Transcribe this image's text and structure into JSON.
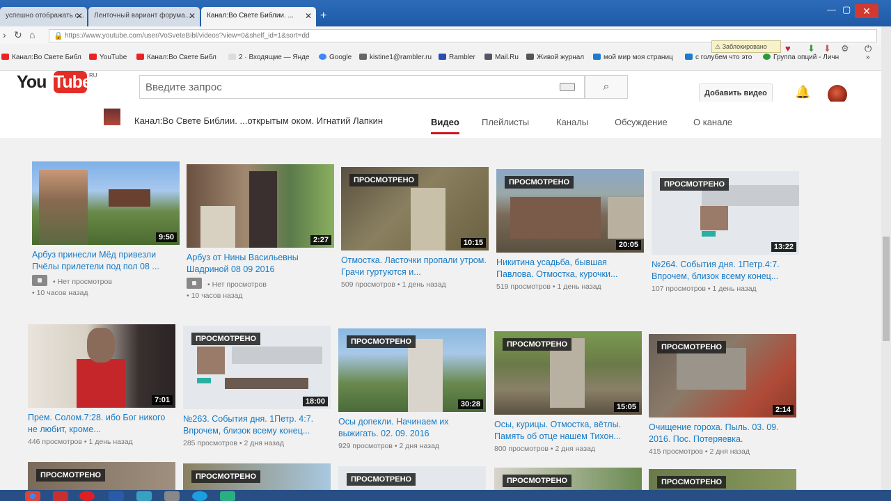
{
  "browser": {
    "tabs": [
      {
        "title": "успешно отображать с...",
        "active": false
      },
      {
        "title": "Ленточный вариант форума...",
        "active": false
      },
      {
        "title": "Канал:Во Свете Библии. ...",
        "active": true
      }
    ],
    "url": "https://www.youtube.com/user/VoSveteBibl/videos?view=0&shelf_id=1&sort=dd",
    "bookmarks": [
      "Канал:Во Свете Библ",
      "YouTube",
      "Канал:Во Свете Библ",
      "2 · Входящие — Янде",
      "Google",
      "kistine1@rambler.ru",
      "Rambler",
      "Mail.Ru",
      "Живой журнал",
      "мой мир моя страниц",
      "с голубем что это",
      "Группа опций - Личн"
    ],
    "blocked_label": "Заблокировано"
  },
  "youtube": {
    "logo_you": "You",
    "logo_tube": "Tube",
    "logo_region": "RU",
    "search_placeholder": "Введите запрос",
    "add_video": "Добавить видео"
  },
  "channel": {
    "name": "Канал:Во Свете Библии. ...открытым оком. Игнатий Лапкин",
    "tabs": [
      "Видео",
      "Плейлисты",
      "Каналы",
      "Обсуждение",
      "О канале"
    ],
    "active_tab": "Видео"
  },
  "watched_label": "ПРОСМОТРЕНО",
  "videos": [
    {
      "title": "Арбуз принесли Мёд привезли Пчёлы прилетели под пол 08 ...",
      "duration": "9:50",
      "views": "Нет просмотров",
      "age": "10 часов назад",
      "watched": false,
      "private": true
    },
    {
      "title": "Арбуз от Нины Васильевны Шадриной 08 09 2016",
      "duration": "2:27",
      "views": "Нет просмотров",
      "age": "10 часов назад",
      "watched": false,
      "private": true
    },
    {
      "title": "Отмостка. Ласточки пропали утром. Грачи гуртуются и...",
      "duration": "10:15",
      "views": "509 просмотров",
      "age": "1 день назад",
      "watched": true,
      "private": false
    },
    {
      "title": "Никитина усадьба, бывшая Павлова. Отмостка, курочки...",
      "duration": "20:05",
      "views": "519 просмотров",
      "age": "1 день назад",
      "watched": true,
      "private": false
    },
    {
      "title": "№264. События дня. 1Петр.4:7. Впрочем, близок всему конец...",
      "duration": "13:22",
      "views": "107 просмотров",
      "age": "1 день назад",
      "watched": true,
      "private": false
    },
    {
      "title": "Прем. Солом.7:28. ибо Бог никого не любит, кроме...",
      "duration": "7:01",
      "views": "446 просмотров",
      "age": "1 день назад",
      "watched": false,
      "private": false
    },
    {
      "title": "№263. События дня. 1Петр. 4:7. Впрочем, близок всему конец...",
      "duration": "18:00",
      "views": "285 просмотров",
      "age": "2 дня назад",
      "watched": true,
      "private": false
    },
    {
      "title": "Осы допекли. Начинаем их выжигать. 02. 09. 2016",
      "duration": "30:28",
      "views": "929 просмотров",
      "age": "2 дня назад",
      "watched": true,
      "private": false
    },
    {
      "title": "Осы, курицы. Отмостка, вётлы. Память об отце нашем Тихон...",
      "duration": "15:05",
      "views": "800 просмотров",
      "age": "2 дня назад",
      "watched": true,
      "private": false
    },
    {
      "title": "Очищение гороха. Пыль. 03. 09. 2016. Пос. Потеряевка.",
      "duration": "2:14",
      "views": "415 просмотров",
      "age": "2 дня назад",
      "watched": true,
      "private": false
    }
  ]
}
